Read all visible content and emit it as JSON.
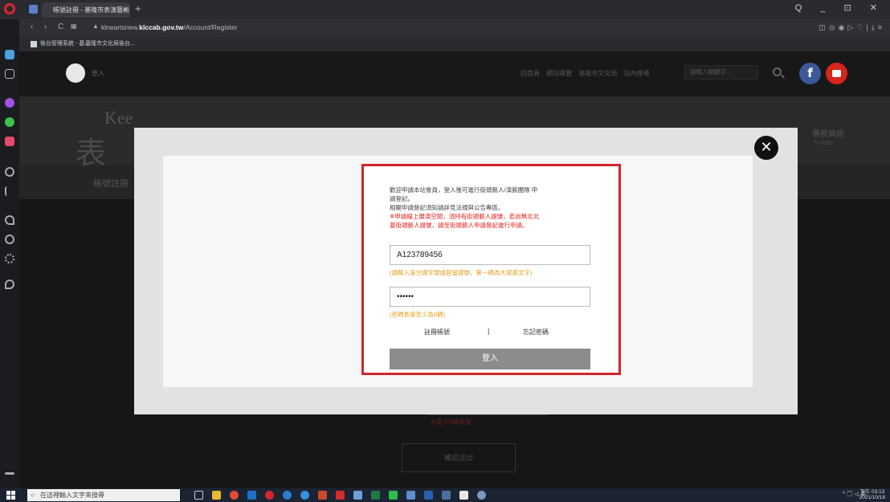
{
  "browser": {
    "tab_title": "帳號註冊 - 基隆市表演藝術",
    "tab_close": "×",
    "new_tab": "+",
    "window_controls": "Q _ ⊡ ✕",
    "url_prefix": "klneartsnew.",
    "url_domain": "klccab.gov.tw",
    "url_path": "/Account/Register",
    "bookmarks": [
      "後台管理系統 - 基...",
      "基隆市文化局後台..."
    ]
  },
  "site": {
    "login_link": "登入",
    "topnav": "回首頁 網站導覽 基隆市文化局 站內搜尋",
    "search_placeholder": "請輸入關鍵字...",
    "facebook_glyph": "f",
    "logo_en": "Kee",
    "logo_cn": "表",
    "tickets_cn": "票務資訊",
    "tickets_en": "Tickets",
    "page_title": "帳號註冊",
    "bg_error": "※最少6碼長度",
    "logout_button": "確認送出"
  },
  "modal": {
    "close_glyph": "✕",
    "intro_line1": "歡迎申請本站會員，登入後可進行街頭藝人/演藝團隊 申",
    "intro_line2": "請登記。",
    "intro_line3": "相關申請登記須知請詳見法規與公告專區。",
    "warn_line1": "※申請線上展演空間，須持有街頭藝人證號，若尚無北北",
    "warn_line2": "基街頭藝人證號，請至街頭藝人申請登記進行申請。",
    "account_value": "A123789456",
    "account_hint": "(請輸入身分證字號或居留證號，第一碼為大寫英文字)",
    "password_value": "••••••",
    "password_hint": "(密碼長度至少為6碼)",
    "register_link": "註冊帳號",
    "separator": "|",
    "forgot_link": "忘記密碼",
    "login_button": "登入"
  },
  "taskbar": {
    "search_placeholder": "在這裡輸入文字來搜尋",
    "tray": "^ 🗔 ◁ 英",
    "time": "下午 03:13",
    "date": "2021/10/18"
  }
}
